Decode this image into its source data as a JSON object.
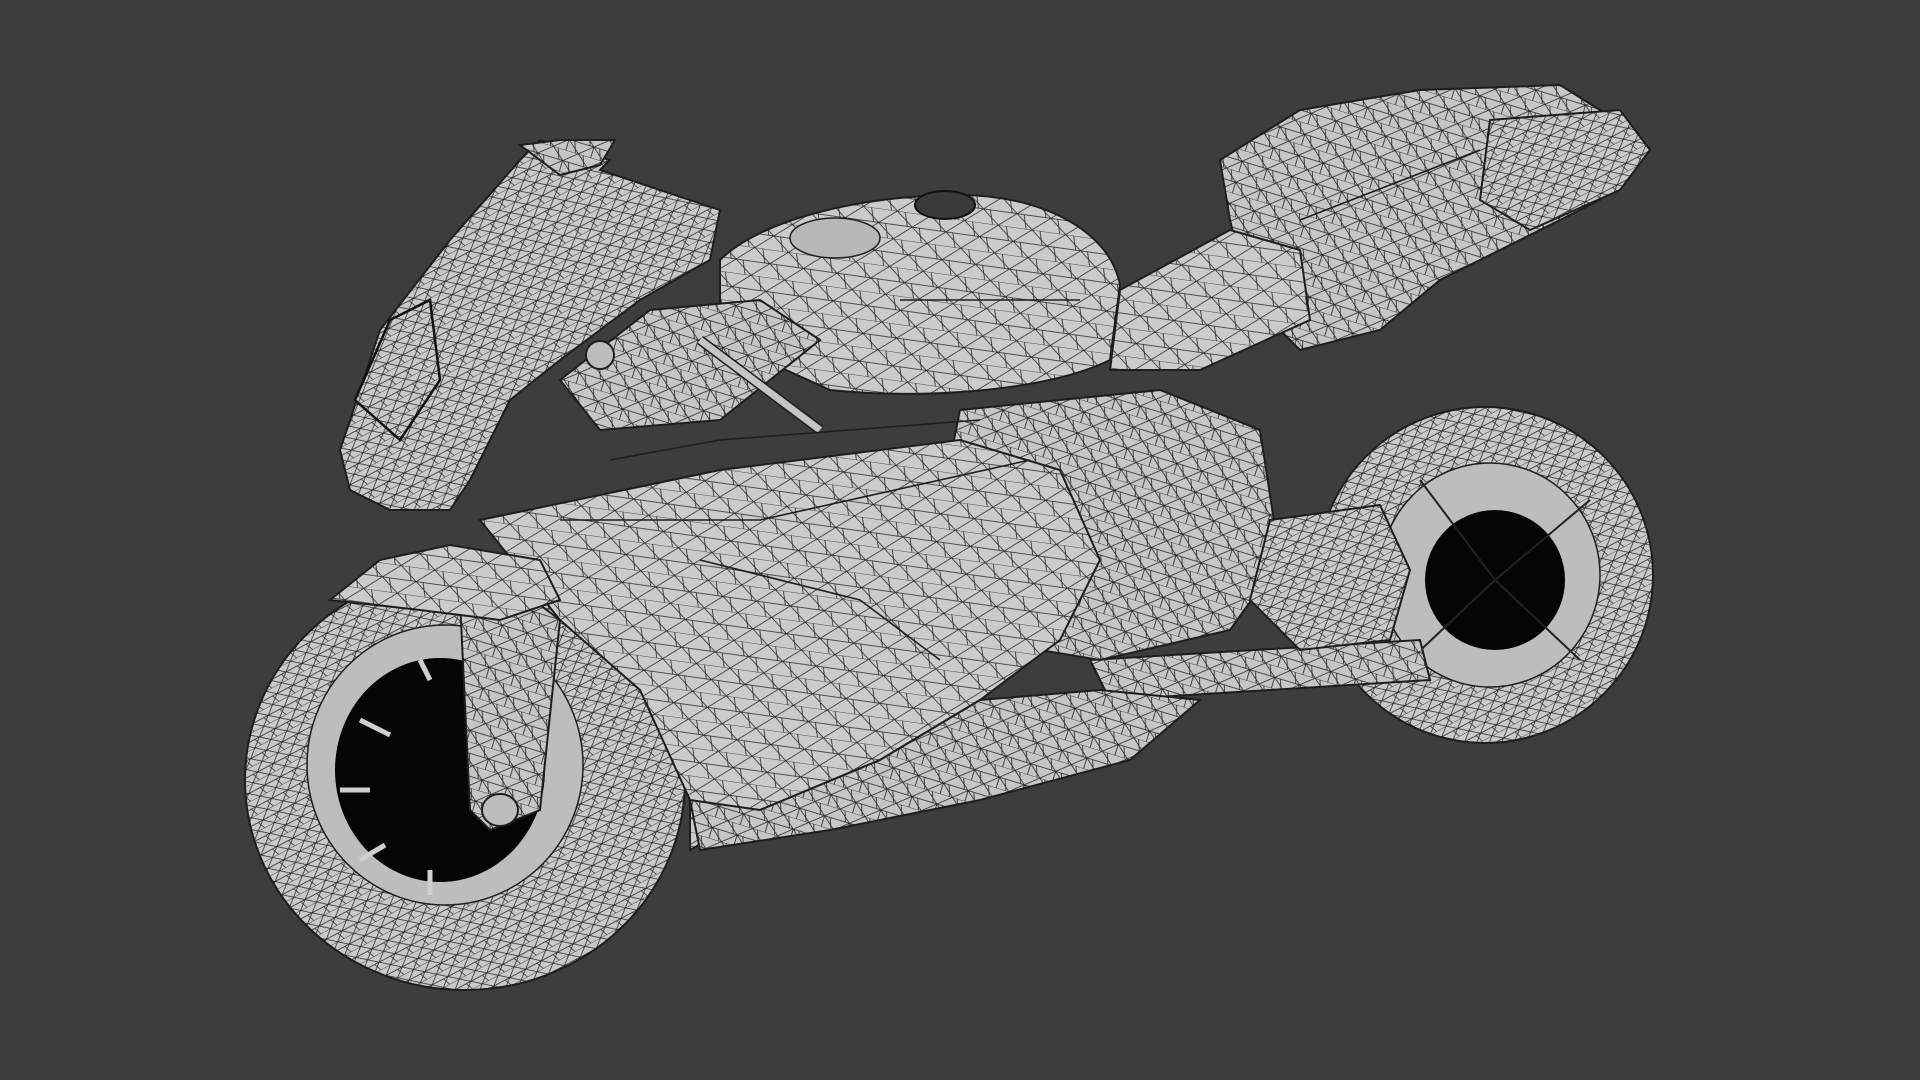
{
  "viewport": {
    "background_color": "#3d3d3d",
    "model": {
      "subject": "motorcycle",
      "render_style": "wireframe-over-solid",
      "surface_color": "#c8c8c8",
      "wire_color": "#1e1e1e",
      "hole_color": "#050505"
    }
  }
}
